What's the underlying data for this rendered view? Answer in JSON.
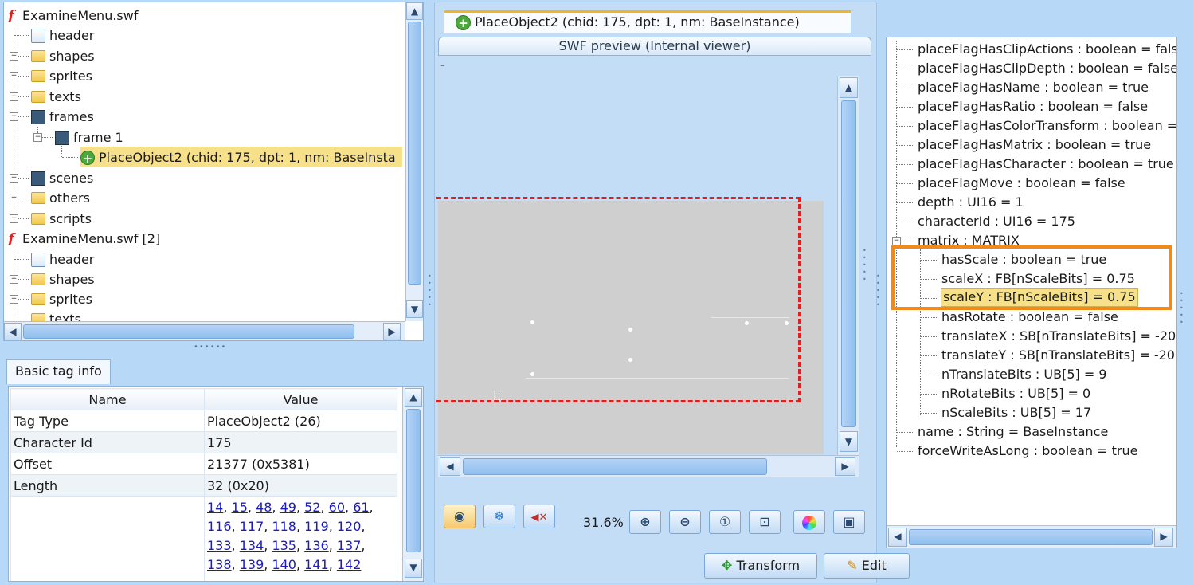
{
  "tree": {
    "items": [
      {
        "label": "ExamineMenu.swf",
        "icon": "swf-icon"
      },
      {
        "label": "header",
        "icon": "file-icon"
      },
      {
        "label": "shapes",
        "icon": "folder-icon"
      },
      {
        "label": "sprites",
        "icon": "folder-icon"
      },
      {
        "label": "texts",
        "icon": "folder-icon"
      },
      {
        "label": "frames",
        "icon": "film-icon"
      },
      {
        "label": "frame 1",
        "icon": "film-icon"
      },
      {
        "label": "PlaceObject2 (chid: 175, dpt: 1, nm: BaseInsta",
        "icon": "plus-icon"
      },
      {
        "label": "scenes",
        "icon": "folder-icon"
      },
      {
        "label": "others",
        "icon": "folder-icon"
      },
      {
        "label": "scripts",
        "icon": "folder-icon"
      },
      {
        "label": "ExamineMenu.swf [2]",
        "icon": "swf-icon"
      },
      {
        "label": "header",
        "icon": "file-icon"
      },
      {
        "label": "shapes",
        "icon": "folder-icon"
      },
      {
        "label": "sprites",
        "icon": "folder-icon"
      },
      {
        "label": "texts",
        "icon": "folder-icon"
      }
    ]
  },
  "info": {
    "tab": "Basic tag info",
    "col_name": "Name",
    "col_value": "Value",
    "rows": [
      {
        "name": "Tag Type",
        "value": "PlaceObject2 (26)"
      },
      {
        "name": "Character Id",
        "value": "175"
      },
      {
        "name": "Offset",
        "value": "21377 (0x5381)"
      },
      {
        "name": "Length",
        "value": "32 (0x20)"
      }
    ],
    "links": [
      "14",
      "15",
      "48",
      "49",
      "52",
      "60",
      "61",
      "116",
      "117",
      "118",
      "119",
      "120",
      "133",
      "134",
      "135",
      "136",
      "137",
      "138",
      "139",
      "140",
      "141",
      "142"
    ]
  },
  "preview": {
    "tab_title": "PlaceObject2 (chid: 175, dpt: 1, nm: BaseInstance)",
    "header": "SWF preview (Internal viewer)",
    "dash": "-",
    "zoom": "31.6%",
    "transform_label": "Transform",
    "edit_label": "Edit"
  },
  "props": {
    "rows": [
      {
        "text": "placeFlagHasClipActions : boolean = false",
        "level": 0
      },
      {
        "text": "placeFlagHasClipDepth : boolean = false",
        "level": 0
      },
      {
        "text": "placeFlagHasName : boolean = true",
        "level": 0
      },
      {
        "text": "placeFlagHasRatio : boolean = false",
        "level": 0
      },
      {
        "text": "placeFlagHasColorTransform : boolean = false",
        "level": 0
      },
      {
        "text": "placeFlagHasMatrix : boolean = true",
        "level": 0
      },
      {
        "text": "placeFlagHasCharacter : boolean = true",
        "level": 0
      },
      {
        "text": "placeFlagMove : boolean = false",
        "level": 0
      },
      {
        "text": "depth : UI16 = 1",
        "level": 0
      },
      {
        "text": "characterId : UI16 = 175",
        "level": 0
      },
      {
        "text": "matrix : MATRIX",
        "level": 0
      },
      {
        "text": "hasScale : boolean = true",
        "level": 1
      },
      {
        "text": "scaleX : FB[nScaleBits] = 0.75",
        "level": 1
      },
      {
        "text": "scaleY : FB[nScaleBits] = 0.75",
        "level": 1
      },
      {
        "text": "hasRotate : boolean = false",
        "level": 1
      },
      {
        "text": "translateX : SB[nTranslateBits] = -20",
        "level": 1
      },
      {
        "text": "translateY : SB[nTranslateBits] = -20",
        "level": 1
      },
      {
        "text": "nTranslateBits : UB[5] = 9",
        "level": 1
      },
      {
        "text": "nRotateBits : UB[5] = 0",
        "level": 1
      },
      {
        "text": "nScaleBits : UB[5] = 17",
        "level": 1
      },
      {
        "text": "name : String = BaseInstance",
        "level": 0
      },
      {
        "text": "forceWriteAsLong : boolean = true",
        "level": 0
      }
    ]
  },
  "colors": {
    "highlight": "#f7e08a",
    "accent": "#f08a1c",
    "dash_red": "#e02020"
  }
}
